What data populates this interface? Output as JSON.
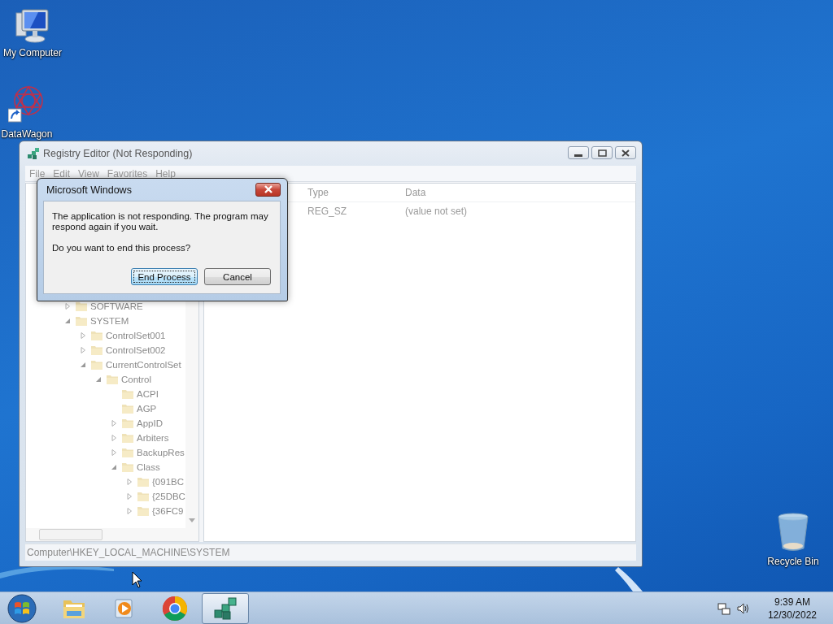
{
  "desktop_icons": [
    {
      "label": "My Computer",
      "kind": "computer"
    },
    {
      "label": "DataWagon",
      "kind": "shortcut"
    },
    {
      "label": "Recycle Bin",
      "kind": "recycle"
    }
  ],
  "registry_window": {
    "title": "Registry Editor (Not Responding)",
    "menu": [
      "File",
      "Edit",
      "View",
      "Favorites",
      "Help"
    ],
    "tree": [
      {
        "label": "SOFTWARE",
        "expanded": false
      },
      {
        "label": "SYSTEM",
        "expanded": true,
        "children": [
          {
            "label": "ControlSet001",
            "expanded": false
          },
          {
            "label": "ControlSet002",
            "expanded": false
          },
          {
            "label": "CurrentControlSet",
            "expanded": true,
            "children": [
              {
                "label": "Control",
                "expanded": true,
                "children": [
                  {
                    "label": "ACPI"
                  },
                  {
                    "label": "AGP"
                  },
                  {
                    "label": "AppID",
                    "expanded": false
                  },
                  {
                    "label": "Arbiters",
                    "expanded": false
                  },
                  {
                    "label": "BackupRes",
                    "expanded": false
                  },
                  {
                    "label": "Class",
                    "expanded": true,
                    "children": [
                      {
                        "label": "{091BC",
                        "expanded": false
                      },
                      {
                        "label": "{25DBC",
                        "expanded": false
                      },
                      {
                        "label": "{36FC9",
                        "expanded": false
                      }
                    ]
                  }
                ]
              }
            ]
          }
        ]
      }
    ],
    "columns": [
      "Type",
      "Data"
    ],
    "rows": [
      [
        "REG_SZ",
        "(value not set)"
      ]
    ],
    "status_bar": "Computer\\HKEY_LOCAL_MACHINE\\SYSTEM"
  },
  "dialog": {
    "title": "Microsoft Windows",
    "message": "The application is not responding. The program may respond again if you wait.",
    "question": "Do you want to end this process?",
    "buttons": [
      {
        "label": "End Process",
        "default": true
      },
      {
        "label": "Cancel",
        "default": false
      }
    ]
  },
  "taskbar": {
    "apps": [
      {
        "kind": "folder",
        "active": false
      },
      {
        "kind": "media",
        "active": false
      },
      {
        "kind": "browser",
        "active": false
      },
      {
        "kind": "registry",
        "active": true
      }
    ],
    "time": "9:39 AM",
    "date": "12/30/2022"
  }
}
